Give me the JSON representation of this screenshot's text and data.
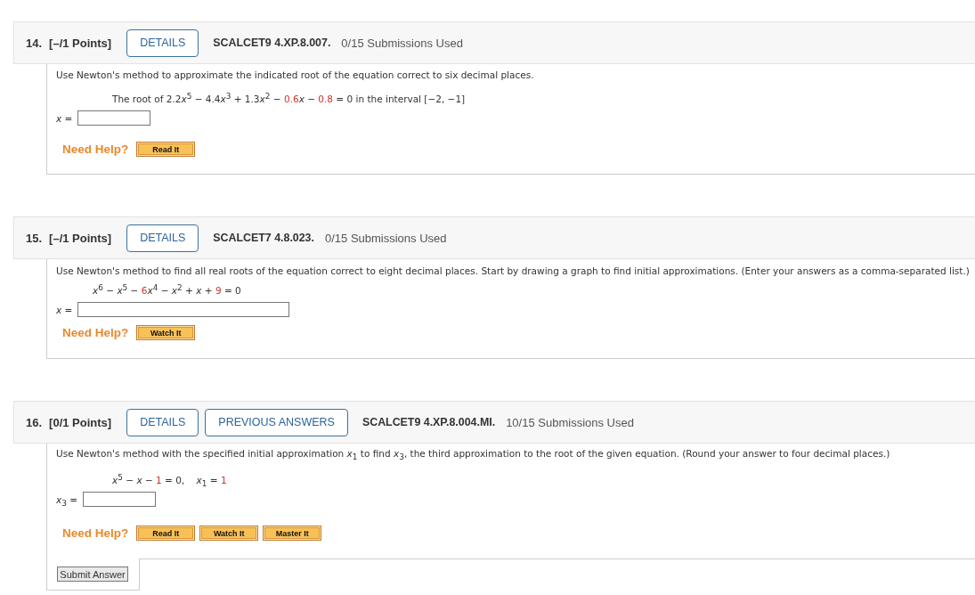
{
  "questions": [
    {
      "number": "14.",
      "points": "[–/1 Points]",
      "buttons": [
        "DETAILS"
      ],
      "code": "SCALCET9 4.XP.8.007.",
      "submissions": "0/15 Submissions Used",
      "instruction": "Use Newton's method to approximate the indicated root of the equation correct to six decimal places.",
      "equation": [
        {
          "text": "The root of 2.2",
          "highlighted": false
        },
        {
          "text": "*x*$^{5}$ − 4.4",
          "highlighted": false
        },
        {
          "text": "*x*$^{3}$ + 1.3",
          "highlighted": false
        },
        {
          "text": "*x*$^{2}$ − ",
          "highlighted": false
        },
        {
          "text": "0.6",
          "highlighted": true
        },
        {
          "text": "*x* − ",
          "highlighted": false
        },
        {
          "text": "0.8",
          "highlighted": true
        },
        {
          "text": " = 0 in the interval [−2, −1]",
          "highlighted": false
        }
      ],
      "answer": {
        "label": "*x* ="
      },
      "help": {
        "label": "Need Help?",
        "buttons": [
          "Read It"
        ]
      }
    },
    {
      "number": "15.",
      "points": "[–/1 Points]",
      "buttons": [
        "DETAILS"
      ],
      "code": "SCALCET7 4.8.023.",
      "submissions": "0/15 Submissions Used",
      "instruction": "Use Newton's method to find all real roots of the equation correct to eight decimal places. Start by drawing a graph to find initial approximations. (Enter your answers as a comma-separated list.)",
      "equation": [
        {
          "text": "*x*$^{6}$ − *x*$^{5}$ − ",
          "highlighted": false
        },
        {
          "text": "6",
          "highlighted": true
        },
        {
          "text": "*x*$^{4}$ − *x*$^{2}$ + *x* + ",
          "highlighted": false
        },
        {
          "text": "9",
          "highlighted": true
        },
        {
          "text": " = 0",
          "highlighted": false
        }
      ],
      "answer": {
        "label": "*x* ="
      },
      "help": {
        "label": "Need Help?",
        "buttons": [
          "Watch It"
        ]
      }
    },
    {
      "number": "16.",
      "points": "[0/1 Points]",
      "buttons": [
        "DETAILS",
        "PREVIOUS ANSWERS"
      ],
      "code": "SCALCET9 4.XP.8.004.MI.",
      "submissions": "10/15 Submissions Used",
      "instruction": "Use Newton's method with the specified initial approximation *x*$_{1}$ to find *x*$_{3}$, the third approximation to the root of the given equation. (Round your answer to four decimal places.)",
      "equation": [
        {
          "text": "*x*$^{5}$ − *x* − ",
          "highlighted": false
        },
        {
          "text": "1",
          "highlighted": true
        },
        {
          "text": " = 0,    *x*$_{1}$ = ",
          "highlighted": false
        },
        {
          "text": "1",
          "highlighted": true
        }
      ],
      "answer": {
        "label": "*x*$_{3}$ ="
      },
      "help": {
        "label": "Need Help?",
        "buttons": [
          "Read It",
          "Watch It",
          "Master It"
        ]
      },
      "submit": "Submit Answer"
    }
  ]
}
